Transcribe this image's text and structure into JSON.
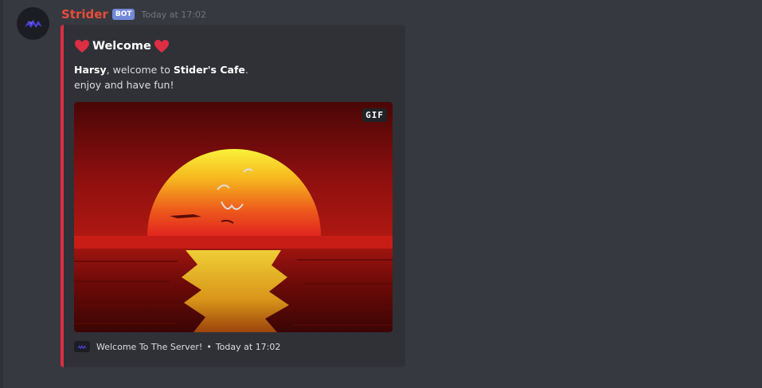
{
  "message": {
    "username": "Strider",
    "bot_tag": "BOT",
    "timestamp": "Today at 17:02",
    "username_color": "#e74c3c"
  },
  "embed": {
    "accent_color": "#dd2e44",
    "title": "Welcome",
    "title_icon": "red-heart-icon",
    "description": {
      "user": "Harsy",
      "mid_text": ", welcome to ",
      "server": "Stider's Cafe",
      "end_text": ".",
      "line2": "enjoy and have fun!"
    },
    "image_badge": "GIF",
    "footer": {
      "text": "Welcome To The Server!",
      "separator": "•",
      "timestamp": "Today at 17:02"
    }
  }
}
